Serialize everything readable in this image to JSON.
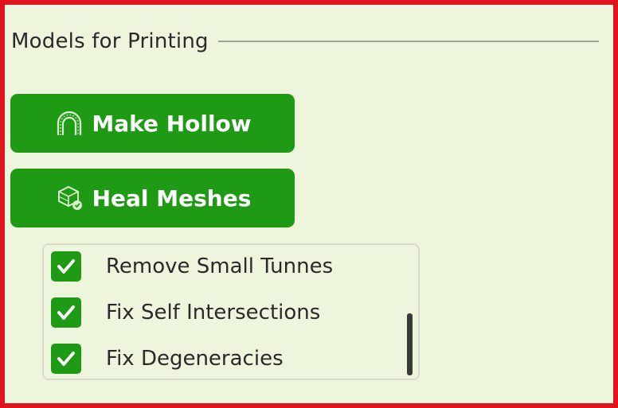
{
  "section": {
    "title": "Models for Printing"
  },
  "buttons": {
    "make_hollow": {
      "label": "Make Hollow",
      "icon": "hollow-arch-icon"
    },
    "heal_meshes": {
      "label": "Heal Meshes",
      "icon": "heal-mesh-icon"
    }
  },
  "options": [
    {
      "label": "Remove Small Tunnes",
      "checked": true
    },
    {
      "label": "Fix Self Intersections",
      "checked": true
    },
    {
      "label": "Fix Degeneracies",
      "checked": true
    }
  ],
  "colors": {
    "frame_border": "#e0141c",
    "panel_background": "#edf5dc",
    "accent_green": "#1e9a15",
    "text": "#2a2a2a"
  }
}
